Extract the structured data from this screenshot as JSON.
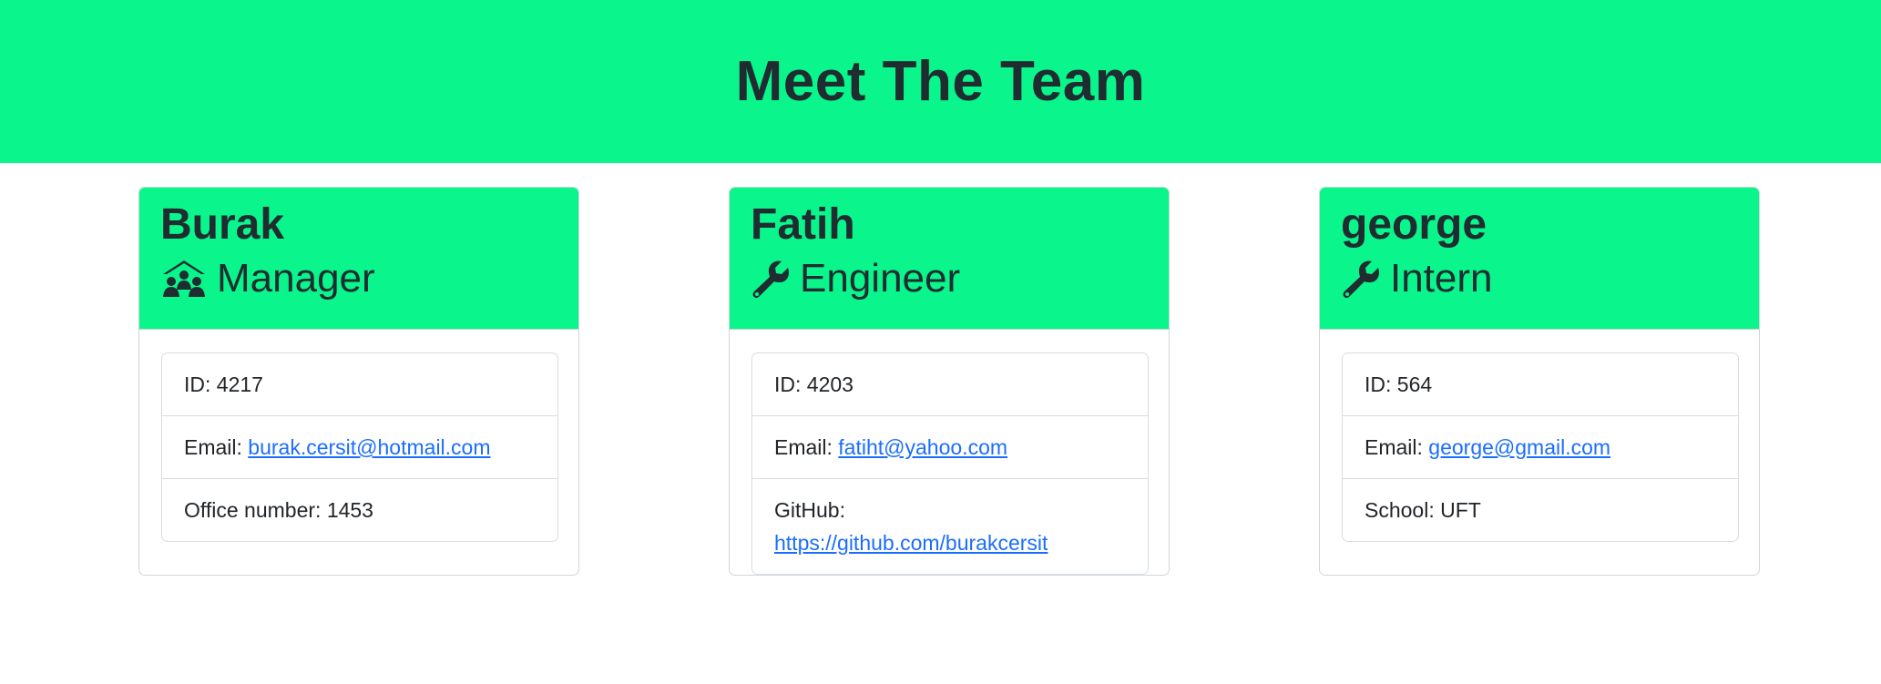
{
  "page": {
    "title": "Meet The Team"
  },
  "team": [
    {
      "name": "Burak",
      "role": "Manager",
      "icon": "manager-team-icon",
      "id_label": "ID: ",
      "id": "4217",
      "email_label": "Email: ",
      "email": "burak.cersit@hotmail.com",
      "extra_label": "Office number: ",
      "extra_value": "1453"
    },
    {
      "name": "Fatih",
      "role": "Engineer",
      "icon": "wrench-icon",
      "id_label": "ID: ",
      "id": "4203",
      "email_label": "Email: ",
      "email": "fatiht@yahoo.com",
      "extra_label": "GitHub:",
      "extra_value": "https://github.com/burakcersit"
    },
    {
      "name": "george",
      "role": "Intern",
      "icon": "wrench-icon",
      "id_label": "ID: ",
      "id": "564",
      "email_label": "Email: ",
      "email": "george@gmail.com",
      "extra_label": "School: ",
      "extra_value": "UFT"
    }
  ],
  "colors": {
    "header_bg": "#0af58b",
    "heading_text": "#1f2d30",
    "link": "#1b6efc"
  }
}
